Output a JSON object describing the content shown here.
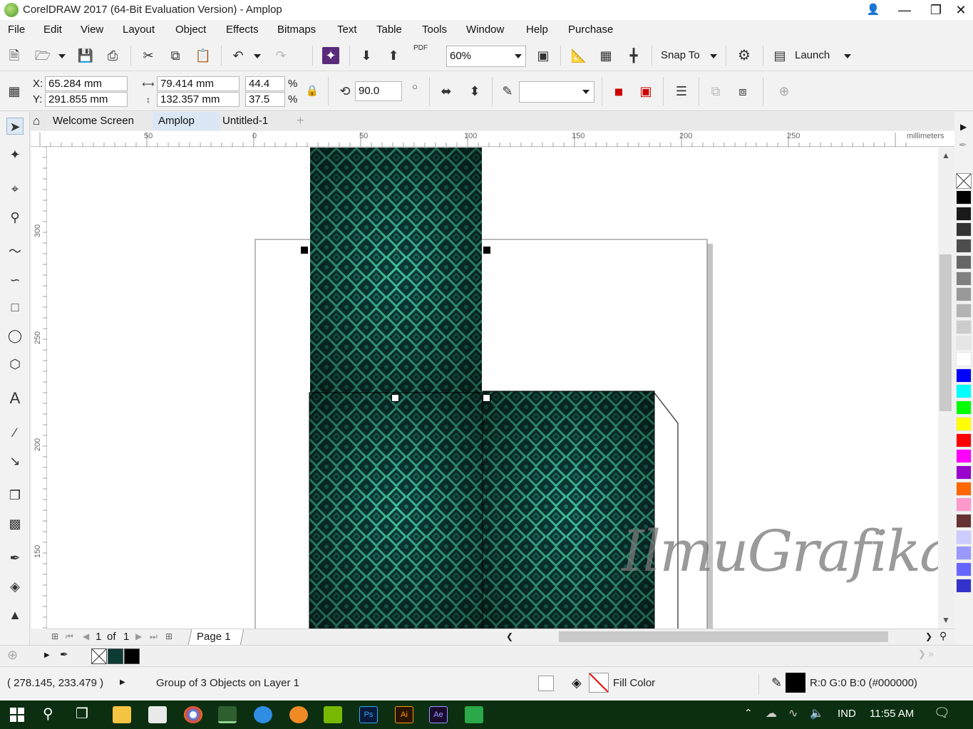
{
  "window": {
    "title": "CorelDRAW 2017 (64-Bit Evaluation Version) - Amplop"
  },
  "menu": [
    "File",
    "Edit",
    "View",
    "Layout",
    "Object",
    "Effects",
    "Bitmaps",
    "Text",
    "Table",
    "Tools",
    "Window",
    "Help",
    "Purchase"
  ],
  "toolbar": {
    "zoom": "60%",
    "snap_to": "Snap To",
    "launch": "Launch",
    "pdf_label": "PDF"
  },
  "properties": {
    "x_label": "X:",
    "y_label": "Y:",
    "x": "65.284 mm",
    "y": "291.855 mm",
    "width": "79.414 mm",
    "height": "132.357 mm",
    "scale_x": "44.4",
    "scale_y": "37.5",
    "percent": "%",
    "rotation": "90.0",
    "outline_width": ""
  },
  "doc_tabs": [
    "Welcome Screen",
    "Amplop",
    "Untitled-1"
  ],
  "ruler": {
    "h_labels": [
      "50",
      "0",
      "50",
      "100",
      "150",
      "200",
      "250"
    ],
    "unit": "millimeters",
    "v_labels": [
      "300",
      "250",
      "200",
      "150"
    ]
  },
  "page_nav": {
    "current": "1",
    "of": "of",
    "total": "1",
    "page_tab": "Page 1"
  },
  "watermark": "IlmuGrafika.id",
  "status": {
    "coords": "( 278.145, 233.479 )",
    "selection": "Group of 3 Objects on Layer 1",
    "fill": "Fill Color",
    "outline_color": "R:0 G:0 B:0 (#000000)"
  },
  "taskbar": {
    "lang": "IND",
    "time": "11:55 AM",
    "apps": [
      "start",
      "search",
      "task-view",
      "file-explorer",
      "mail",
      "chrome",
      "coreldraw",
      "edge",
      "torch",
      "nvidia",
      "photoshop",
      "illustrator",
      "after-effects",
      "camtasia"
    ]
  },
  "palette_colors": [
    "#000000",
    "#1a1a1a",
    "#333333",
    "#4d4d4d",
    "#666666",
    "#808080",
    "#999999",
    "#b3b3b3",
    "#cccccc",
    "#e6e6e6",
    "#ffffff",
    "#0000ff",
    "#00ffff",
    "#00ff00",
    "#ffff00",
    "#ff0000",
    "#ff00ff",
    "#9900cc",
    "#ff6600",
    "#ff99cc",
    "#663333",
    "#ccccff",
    "#9999ff",
    "#6666ff",
    "#3333cc"
  ],
  "pattern_colors": {
    "dark": "#0c3b35",
    "mid": "#1f7a6a",
    "light": "#4fd6b0"
  }
}
